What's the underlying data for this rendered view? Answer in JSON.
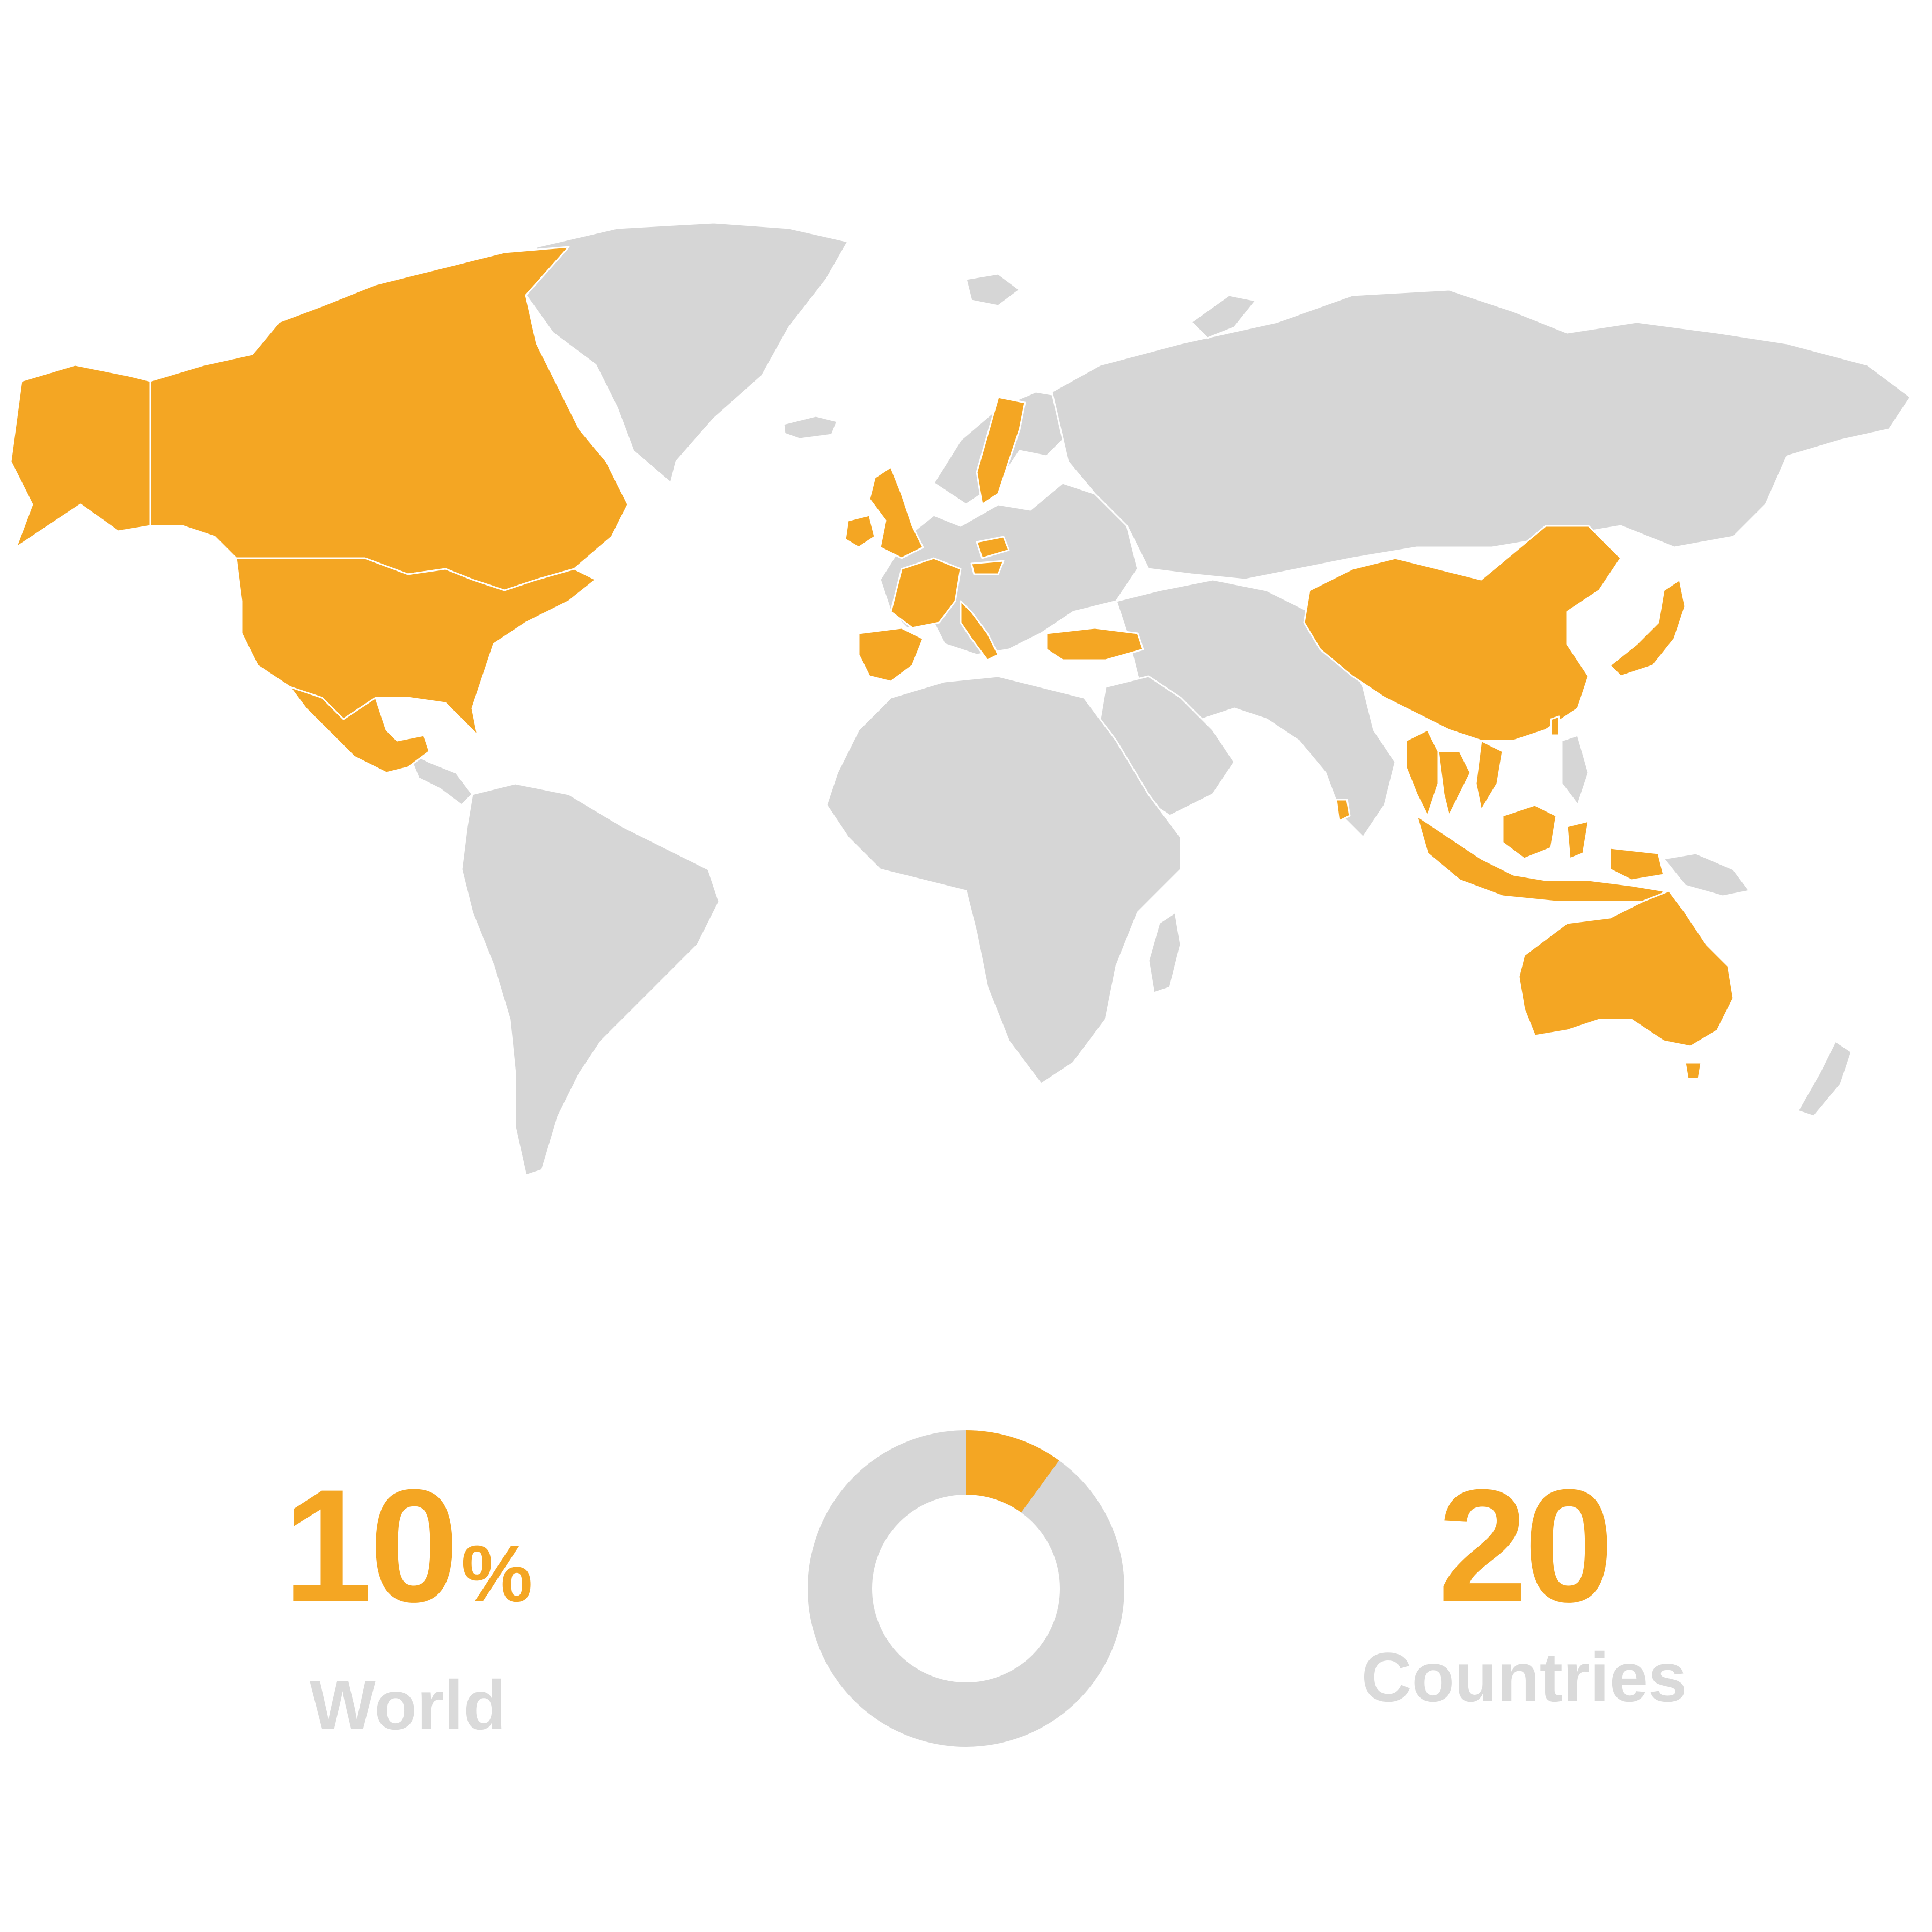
{
  "colors": {
    "visited": "#F4A623",
    "unvisited": "#D6D6D6",
    "border": "#FFFFFF",
    "label": "#DADADA",
    "background": "#FFFFFF"
  },
  "map": {
    "visited_countries": [
      "Canada",
      "United States",
      "Mexico",
      "United Kingdom",
      "Ireland",
      "France",
      "Spain",
      "Italy",
      "Sweden",
      "Czech Republic",
      "Austria",
      "Turkey",
      "China",
      "Japan",
      "Taiwan",
      "Thailand",
      "Myanmar",
      "Vietnam",
      "Malaysia",
      "Indonesia",
      "Sri Lanka",
      "Australia"
    ]
  },
  "stats": {
    "world": {
      "value": "10",
      "unit": "%",
      "label": "World",
      "fraction": 0.1
    },
    "countries": {
      "value": "20",
      "label": "Countries"
    }
  }
}
